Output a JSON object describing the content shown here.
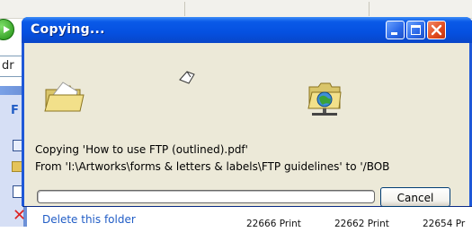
{
  "background": {
    "address_text": "dr",
    "taskpane_heading": "F",
    "task_delete": "Delete this folder",
    "file_items": [
      "22666 Print",
      "22662 Print",
      "22654 Pr"
    ]
  },
  "dialog": {
    "title": "Copying...",
    "copying_line": "Copying 'How to use FTP (outlined).pdf'",
    "from_line": "From 'I:\\Artworks\\forms & letters & labels\\FTP guidelines' to '/BOB",
    "progress_fraction": 0,
    "cancel_label": "Cancel",
    "icons": {
      "source": "folder-icon",
      "destination": "network-folder-icon",
      "animation": "flying-document-icon",
      "minimize": "minimize-icon",
      "maximize": "maximize-icon",
      "close": "close-icon"
    },
    "colors": {
      "titlebar": "#0550e0",
      "body": "#ece9d8",
      "close": "#e04a1c",
      "progress": "#2fb82a"
    }
  }
}
